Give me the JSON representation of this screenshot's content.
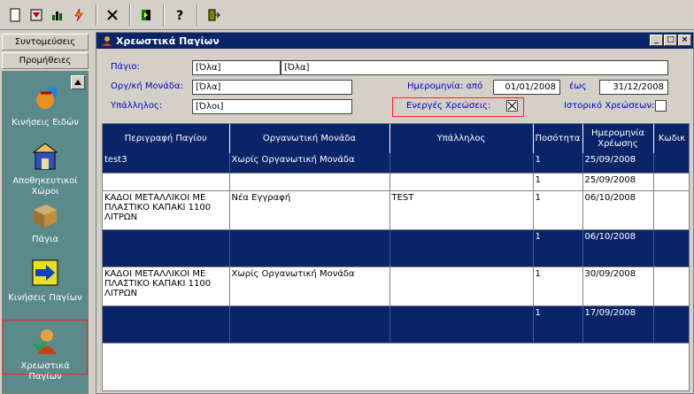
{
  "toolbar": {
    "buttons": [
      {
        "name": "new-doc-icon",
        "glyph": "🗋"
      },
      {
        "name": "filter-icon",
        "glyph": "▼"
      },
      {
        "name": "chart-icon",
        "glyph": "▥"
      },
      {
        "name": "lightning-icon",
        "glyph": "⚡"
      },
      {
        "name": "close-x-icon",
        "glyph": "✕"
      },
      {
        "name": "bookmark-icon",
        "glyph": "◧"
      },
      {
        "name": "help-icon",
        "glyph": "?"
      },
      {
        "name": "exit-icon",
        "glyph": "⇥"
      }
    ]
  },
  "sidebar": {
    "tabs": [
      "Συντομεύσεις",
      "Προμήθειες"
    ],
    "items": [
      {
        "label": "Κινήσεις Ειδών",
        "icon": "movement-icon"
      },
      {
        "label": "Αποθηκευτικοί Χώροι",
        "icon": "warehouse-icon"
      },
      {
        "label": "Πάγια",
        "icon": "assets-icon"
      },
      {
        "label": "Κινήσεις Παγίων",
        "icon": "asset-movement-icon"
      },
      {
        "label": "Χρεωστικά Παγίων",
        "icon": "person-icon"
      }
    ]
  },
  "window": {
    "title": "Χρεωστικά Παγίων",
    "buttons": [
      "_",
      "□",
      "×"
    ]
  },
  "form": {
    "asset_label": "Πάγιο:",
    "asset_code": "[Όλα]",
    "asset_desc": "[Όλα]",
    "org_label": "Οργ/κή Μονάδα:",
    "org_value": "[Όλα]",
    "emp_label": "Υπάλληλος:",
    "emp_value": "[Όλοι]",
    "date_from_label": "Ημερομηνία: από",
    "date_from": "01/01/2008",
    "date_to_label": "έως",
    "date_to": "31/12/2008",
    "active_label": "Ενεργές Χρεώσεις:",
    "history_label": "Ιστορικό Χρεώσεων:"
  },
  "grid": {
    "columns": [
      "Περιγραφή Παγίου",
      "Οργανωτική Μονάδα",
      "Υπάλληλος",
      "Ποσότητα",
      "Ημερομηνία Χρέωσης",
      "Κωδικ"
    ],
    "rows": [
      {
        "style": "dark",
        "cells": [
          "test3",
          "Χωρίς Οργανωτική Μονάδα",
          "",
          "1",
          "25/09/2008",
          ""
        ]
      },
      {
        "style": "light",
        "cells": [
          "",
          "",
          "",
          "1",
          "25/09/2008",
          ""
        ]
      },
      {
        "style": "light",
        "cells": [
          "ΚΑΔΟΙ ΜΕΤΑΛΛΙΚΟΙ ΜΕ ΠΛΑΣΤΙΚΟ ΚΑΠΑΚΙ 1100 ΛΙΤΡΩΝ",
          "Νέα Εγγραφή",
          "TEST",
          "1",
          "06/10/2008",
          ""
        ]
      },
      {
        "style": "dark",
        "cells": [
          "",
          "",
          "",
          "1",
          "06/10/2008",
          ""
        ]
      },
      {
        "style": "light",
        "cells": [
          "ΚΑΔΟΙ ΜΕΤΑΛΛΙΚΟΙ ΜΕ ΠΛΑΣΤΙΚΟ ΚΑΠΑΚΙ 1100 ΛΙΤΡΩΝ",
          "Χωρίς Οργανωτική Μονάδα",
          "",
          "1",
          "30/09/2008",
          ""
        ]
      },
      {
        "style": "dark",
        "cells": [
          "",
          "",
          "",
          "1",
          "17/09/2008",
          ""
        ]
      }
    ]
  },
  "colors": {
    "titlebar": "#0a246a",
    "label": "#0000cc",
    "highlight": "#ff2020",
    "sidebar": "#5b8a8a"
  }
}
